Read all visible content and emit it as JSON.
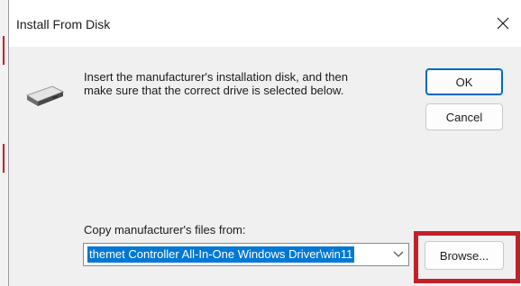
{
  "dialog": {
    "title": "Install From Disk",
    "close_glyph": "✕",
    "message": "Insert the manufacturer's installation disk, and then\nmake sure that the correct drive is selected below.",
    "buttons": {
      "ok": "OK",
      "cancel": "Cancel",
      "browse": "Browse..."
    },
    "copy_from_label": "Copy manufacturer's files from:",
    "copy_from_value": "themet Controller All-In-One Windows Driver\\win11",
    "icons": {
      "disk": "disk-drive-icon",
      "dropdown": "chevron-down-icon",
      "close": "close-icon"
    },
    "colors": {
      "selection": "#0078d4",
      "default_button_border": "#0067c0",
      "highlight_box": "#c31f29"
    }
  }
}
